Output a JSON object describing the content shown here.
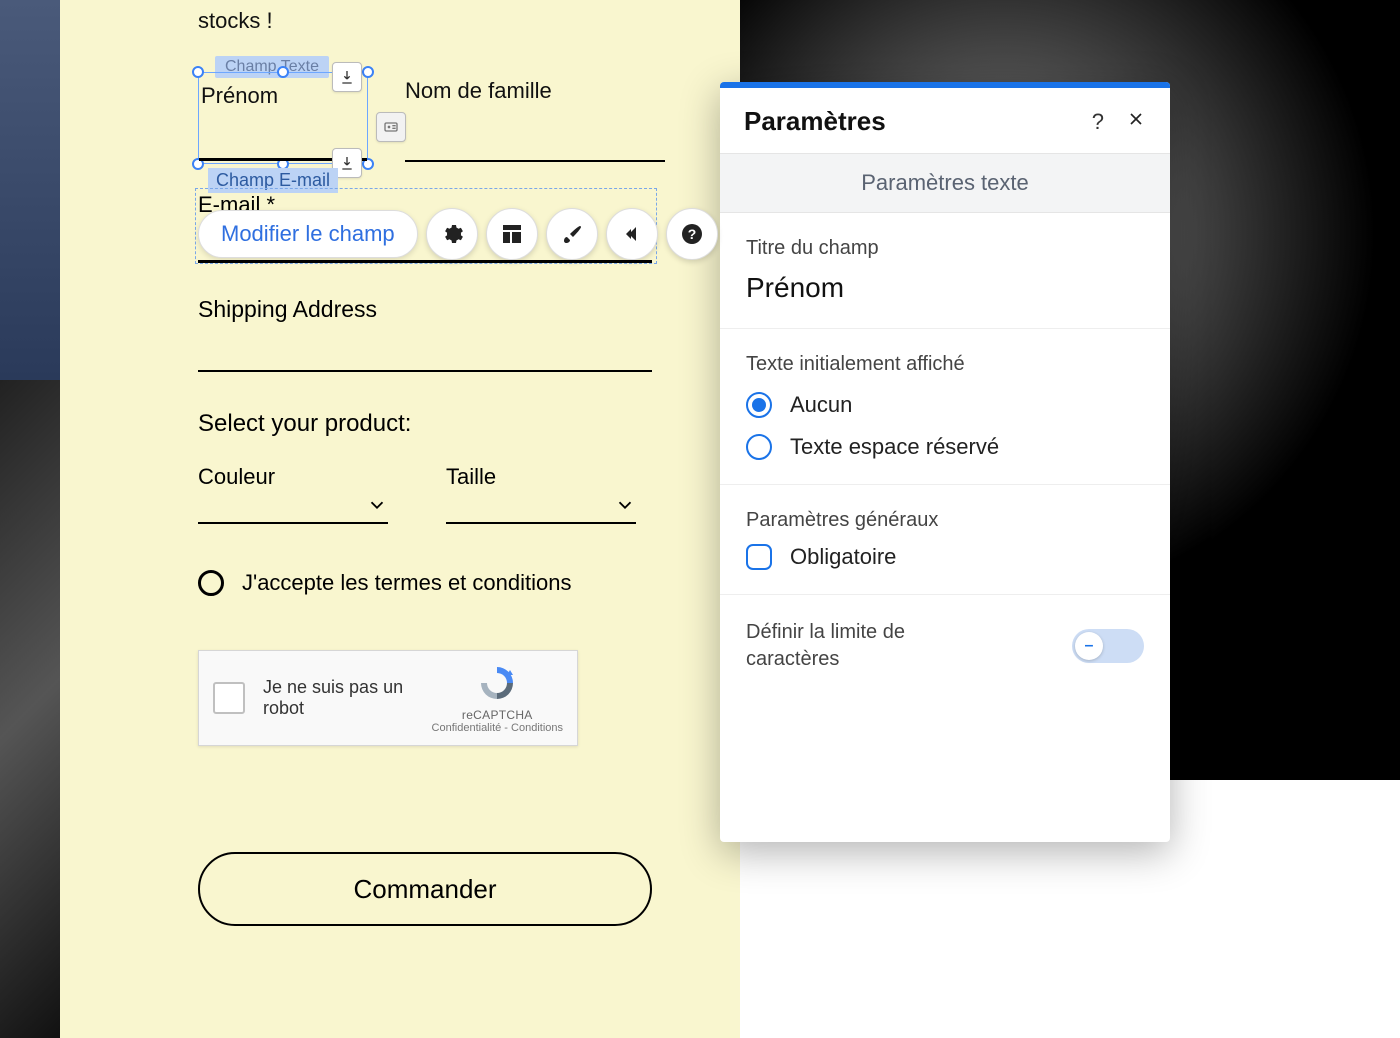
{
  "intro": "stocks !",
  "form": {
    "firstname_label": "Prénom",
    "lastname_label": "Nom de famille",
    "email_label": "E-mail *",
    "shipping_label": "Shipping Address",
    "select_product_title": "Select your product:",
    "color_label": "Couleur",
    "size_label": "Taille",
    "terms_text": "J'accepte les termes et conditions",
    "order_button": "Commander"
  },
  "selection": {
    "text_tag": "Champ Texte",
    "email_tag": "Champ E-mail"
  },
  "toolbar": {
    "edit_field": "Modifier le champ"
  },
  "recaptcha": {
    "text": "Je ne suis pas un robot",
    "brand": "reCAPTCHA",
    "footer": "Confidentialité - Conditions"
  },
  "panel": {
    "title": "Paramètres",
    "subhead": "Paramètres texte",
    "field_title_label": "Titre du champ",
    "field_title_value": "Prénom",
    "initial_text_label": "Texte initialement affiché",
    "option_none": "Aucun",
    "option_placeholder": "Texte espace réservé",
    "general_label": "Paramètres généraux",
    "required_label": "Obligatoire",
    "char_limit_label": "Définir la limite de caractères"
  }
}
